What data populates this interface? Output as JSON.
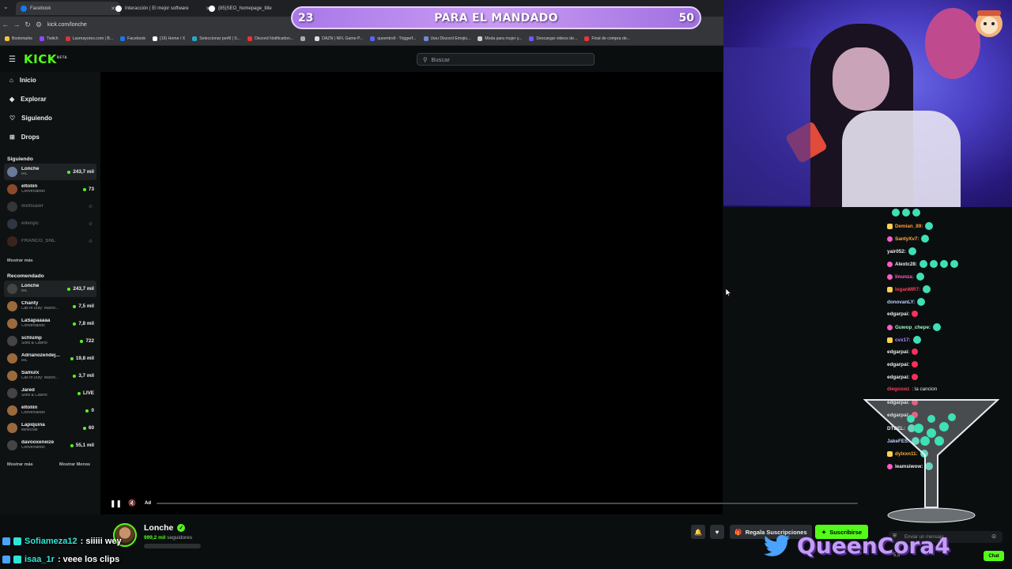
{
  "browser": {
    "tabs": [
      {
        "title": "Facebook",
        "color": "#1877f2"
      },
      {
        "title": "Interacción | El mejor software",
        "color": "#ffffff"
      },
      {
        "title": "(85)SEO_homepage_title",
        "color": "#ffffff"
      }
    ],
    "url": "kick.com/lonche",
    "bookmarks": [
      {
        "label": "Bookmarks",
        "color": "#f5c542"
      },
      {
        "label": "Twitch",
        "color": "#9146ff"
      },
      {
        "label": "Lasmayores.com | B...",
        "color": "#d33"
      },
      {
        "label": "Facebook",
        "color": "#1877f2"
      },
      {
        "label": "(16) Home / X",
        "color": "#ffffff"
      },
      {
        "label": "Seleccionar perfil | S...",
        "color": "#2ac"
      },
      {
        "label": "Discord Notification...",
        "color": "#e33"
      },
      {
        "label": "",
        "color": "#aaa"
      },
      {
        "label": "DAZN | NFL Game P...",
        "color": "#ddd"
      },
      {
        "label": "queentroll - Triggerf...",
        "color": "#5865f2"
      },
      {
        "label": "Uwu Discord Emojis...",
        "color": "#7289da"
      },
      {
        "label": "Moda para mujer y...",
        "color": "#ccc"
      },
      {
        "label": "Descargar videos de...",
        "color": "#6a5cff"
      },
      {
        "label": "Final de compra de...",
        "color": "#e33"
      }
    ]
  },
  "kick": {
    "logo": "KICK",
    "logo_sup": "BETA",
    "search_placeholder": "Buscar",
    "nav": [
      {
        "label": "Inicio",
        "icon": "home-icon"
      },
      {
        "label": "Explorar",
        "icon": "compass-icon"
      },
      {
        "label": "Siguiendo",
        "icon": "heart-icon"
      },
      {
        "label": "Drops",
        "icon": "gift-icon"
      }
    ],
    "following_title": "Siguiendo",
    "following": [
      {
        "name": "Lonche",
        "category": "IRL",
        "viewers": "243,7 mil",
        "live": true
      },
      {
        "name": "eltoliin",
        "category": "Conversando",
        "viewers": "73",
        "live": true
      },
      {
        "name": "mofisaier",
        "category": "",
        "viewers": "",
        "live": false
      },
      {
        "name": "edenpc",
        "category": "",
        "viewers": "",
        "live": false
      },
      {
        "name": "FRANCO_SNL",
        "category": "",
        "viewers": "",
        "live": false
      }
    ],
    "show_more": "Mostrar más",
    "recommended_title": "Recomendado",
    "recommended": [
      {
        "name": "Lonche",
        "category": "IRL",
        "viewers": "243,7 mil"
      },
      {
        "name": "Chanty",
        "category": "Call of Duty: Warzo...",
        "viewers": "7,5 mil"
      },
      {
        "name": "LaSapaaaaa",
        "category": "Conversando",
        "viewers": "7,8 mil"
      },
      {
        "name": "schlump",
        "category": "Slots & Casino",
        "viewers": "722"
      },
      {
        "name": "Adrianozendej...",
        "category": "IRL",
        "viewers": "19,8 mil"
      },
      {
        "name": "Samulx",
        "category": "Call of Duty: Warzo...",
        "viewers": "3,7 mil"
      },
      {
        "name": "Jared",
        "category": "Slots & Casino",
        "viewers": "LIVE"
      },
      {
        "name": "eltoliin",
        "category": "Conversando",
        "viewers": "0"
      },
      {
        "name": "Lapiquina",
        "category": "Minecraft",
        "viewers": "60"
      },
      {
        "name": "davooxeneize",
        "category": "Conversando",
        "viewers": "55,1 mil"
      }
    ],
    "show_more_2": "Mostrar más",
    "show_less": "Mostrar Menos",
    "player": {
      "ad_label": "Ad",
      "progress": 0.0
    },
    "streamer": {
      "name": "Lonche",
      "followers_count": "999,2 mil",
      "followers_label": "seguidores"
    },
    "gift_label": "Regala Suscripciones",
    "subscribe_label": "Suscribirse",
    "chat_input_placeholder": "Enviar un mensaje",
    "chat_button": "Chat",
    "viewer_count": "5,5"
  },
  "overlay": {
    "banner_left": "23",
    "banner_title": "PARA EL MANDADO",
    "banner_right": "50",
    "chat": [
      {
        "user": "Sofiameza12",
        "text": ": siiiii wey"
      },
      {
        "user": "isaa_1r",
        "text": ": veee los clips"
      }
    ],
    "brand": "QueenCora4",
    "brand_icon": "twitter-bird-icon"
  },
  "chat_messages": [
    {
      "user": "Demian_89:",
      "color": "#ff9b3d",
      "badge": "sub",
      "emotes": 1,
      "text": ""
    },
    {
      "user": "SantyXv7:",
      "color": "#ffb03b",
      "badge": "mod",
      "emotes": 1,
      "text": ""
    },
    {
      "user": "yair052:",
      "color": "#eeeeee",
      "badge": "",
      "emotes": 1,
      "text": ""
    },
    {
      "user": "Alextc28:",
      "color": "#eeeeee",
      "badge": "mod",
      "emotes": 4,
      "text": ""
    },
    {
      "user": "linunza:",
      "color": "#ff5cc8",
      "badge": "mod",
      "emotes": 1,
      "text": ""
    },
    {
      "user": "loganMR7:",
      "color": "#ff3b5c",
      "badge": "sub",
      "emotes": 1,
      "text": ""
    },
    {
      "user": "donovanLY:",
      "color": "#bcd3ff",
      "badge": "",
      "emotes": 1,
      "text": ""
    },
    {
      "user": "edgarpai:",
      "color": "#eeeeee",
      "badge": "",
      "emotes": 0,
      "heart": true,
      "text": ""
    },
    {
      "user": "Guwop_chepe:",
      "color": "#9ef5c7",
      "badge": "mod",
      "emotes": 1,
      "text": ""
    },
    {
      "user": "cvx17:",
      "color": "#b58cff",
      "badge": "sub",
      "emotes": 1,
      "text": ""
    },
    {
      "user": "edgarpai:",
      "color": "#eeeeee",
      "badge": "",
      "emotes": 0,
      "heart": true,
      "text": ""
    },
    {
      "user": "edgarpai:",
      "color": "#eeeeee",
      "badge": "",
      "emotes": 0,
      "heart": true,
      "text": ""
    },
    {
      "user": "edgarpai:",
      "color": "#eeeeee",
      "badge": "",
      "emotes": 0,
      "heart": true,
      "text": ""
    },
    {
      "user": "diegoswz",
      "color": "#ff3b5c",
      "badge": "",
      "emotes": 0,
      "text": ": la cancion"
    },
    {
      "user": "edgarpai:",
      "color": "#eeeeee",
      "badge": "",
      "emotes": 0,
      "heart": true,
      "text": ""
    },
    {
      "user": "edgarpai:",
      "color": "#eeeeee",
      "badge": "",
      "emotes": 0,
      "heart": true,
      "text": ""
    },
    {
      "user": "DTDEL:",
      "color": "#eeeeee",
      "badge": "",
      "emotes": 1,
      "text": ""
    },
    {
      "user": "JakeFES:",
      "color": "#bcd3ff",
      "badge": "",
      "emotes": 1,
      "text": ""
    },
    {
      "user": "dylxxn11:",
      "color": "#ffb03b",
      "badge": "sub",
      "emotes": 1,
      "text": ""
    },
    {
      "user": "leamsiwow:",
      "color": "#eeeeee",
      "badge": "mod",
      "emotes": 1,
      "text": ""
    }
  ],
  "colors": {
    "accent": "#53fc18",
    "banner": "#b889ef",
    "webcam": "#4a3fc4"
  }
}
